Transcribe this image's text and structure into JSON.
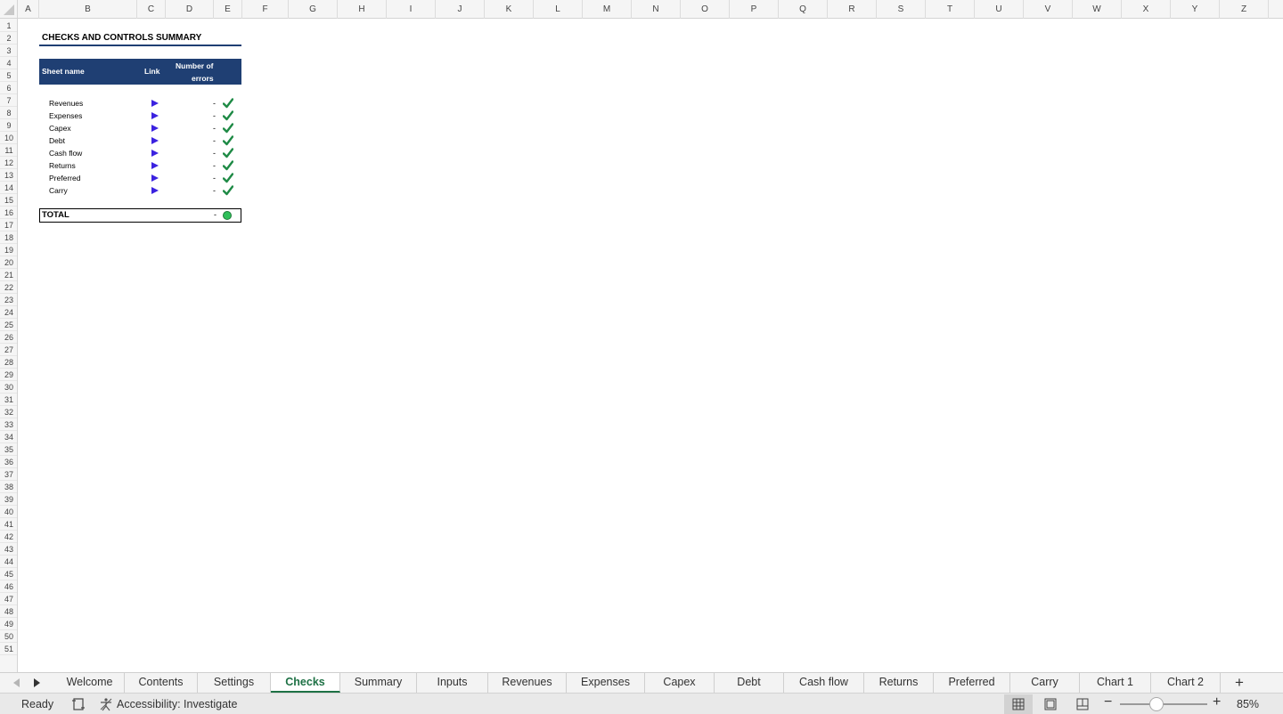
{
  "columns": [
    "A",
    "B",
    "C",
    "D",
    "E",
    "F",
    "G",
    "H",
    "I",
    "J",
    "K",
    "L",
    "M",
    "N",
    "O",
    "P",
    "Q",
    "R",
    "S",
    "T",
    "U",
    "V",
    "W",
    "X",
    "Y",
    "Z"
  ],
  "rows": [
    "1",
    "2",
    "3",
    "4",
    "5",
    "6",
    "7",
    "8",
    "9",
    "10",
    "11",
    "12",
    "13",
    "14",
    "15",
    "16",
    "17",
    "18",
    "19",
    "20",
    "21",
    "22",
    "23",
    "24",
    "25",
    "26",
    "27",
    "28",
    "29",
    "30",
    "31",
    "32",
    "33",
    "34",
    "35",
    "36",
    "37",
    "38",
    "39",
    "40",
    "41",
    "42",
    "43",
    "44",
    "45",
    "46",
    "47",
    "48",
    "49",
    "50",
    "51"
  ],
  "sheet": {
    "title": "CHECKS AND CONTROLS SUMMARY",
    "header": {
      "sheet_name": "Sheet name",
      "link": "Link",
      "errors_line1": "Number of",
      "errors_line2": "errors"
    },
    "items": [
      {
        "name": "Revenues",
        "errors": "-"
      },
      {
        "name": "Expenses",
        "errors": "-"
      },
      {
        "name": "Capex",
        "errors": "-"
      },
      {
        "name": "Debt",
        "errors": "-"
      },
      {
        "name": "Cash flow",
        "errors": "-"
      },
      {
        "name": "Returns",
        "errors": "-"
      },
      {
        "name": "Preferred",
        "errors": "-"
      },
      {
        "name": "Carry",
        "errors": "-"
      }
    ],
    "total": {
      "label": "TOTAL",
      "value": "-",
      "status_color": "#2fbf5a"
    },
    "colors": {
      "header_band": "#1f3f73",
      "link_arrow": "#3b22e0",
      "check": "#1e8a45"
    }
  },
  "tabs": [
    {
      "label": "Welcome"
    },
    {
      "label": "Contents"
    },
    {
      "label": "Settings"
    },
    {
      "label": "Checks",
      "active": true
    },
    {
      "label": "Summary"
    },
    {
      "label": "Inputs"
    },
    {
      "label": "Revenues"
    },
    {
      "label": "Expenses"
    },
    {
      "label": "Capex"
    },
    {
      "label": "Debt"
    },
    {
      "label": "Cash flow"
    },
    {
      "label": "Returns"
    },
    {
      "label": "Preferred"
    },
    {
      "label": "Carry"
    },
    {
      "label": "Chart 1"
    },
    {
      "label": "Chart 2"
    }
  ],
  "status": {
    "ready": "Ready",
    "accessibility": "Accessibility: Investigate",
    "zoom": "85%",
    "icons": [
      "macro-record-icon",
      "accessibility-icon",
      "normal-view-icon",
      "page-layout-icon",
      "page-break-icon"
    ]
  }
}
